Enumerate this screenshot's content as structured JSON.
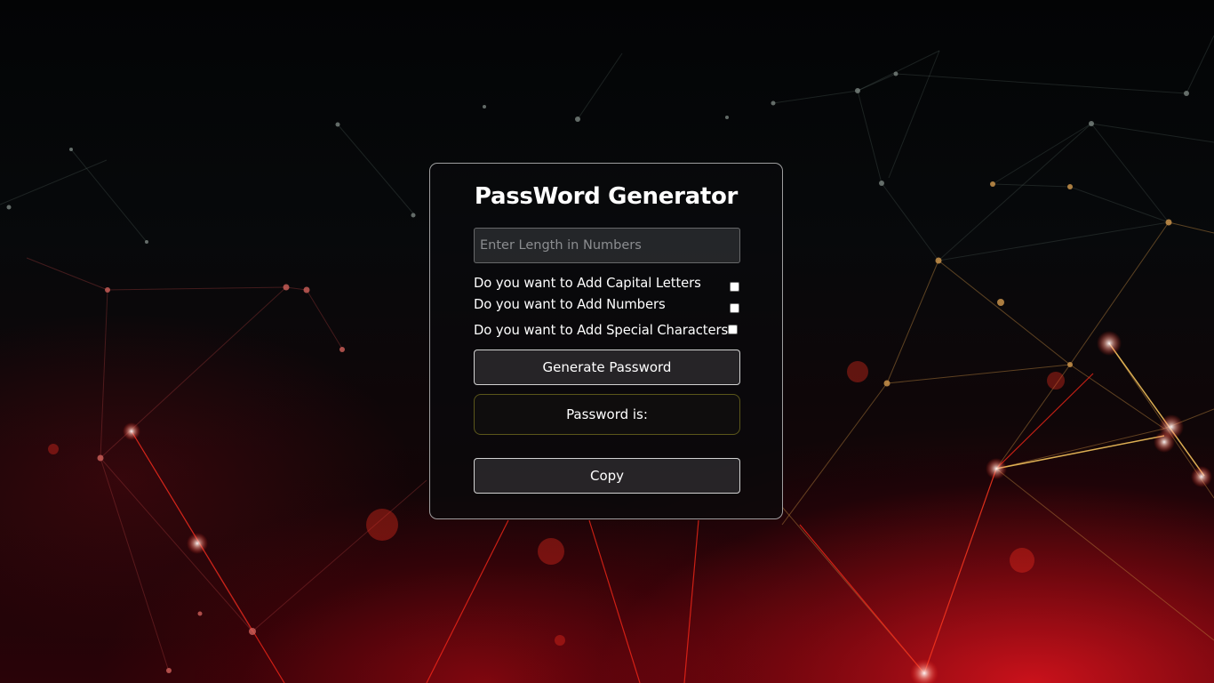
{
  "form": {
    "title": "PassWord Generator",
    "length_input": {
      "placeholder": "Enter Length in Numbers",
      "value": ""
    },
    "options": [
      {
        "label": "Do you want to Add Capital Letters",
        "checked": false
      },
      {
        "label": "Do you want to Add Numbers",
        "checked": false
      },
      {
        "label": "Do you want to Add Special Characters",
        "checked": false
      }
    ],
    "generate_button": "Generate Password",
    "result_label": "Password is:",
    "copy_button": "Copy"
  },
  "colors": {
    "accent_red": "#e0141e",
    "panel_border": "#d2d2d2",
    "result_border": "#6e691e"
  }
}
